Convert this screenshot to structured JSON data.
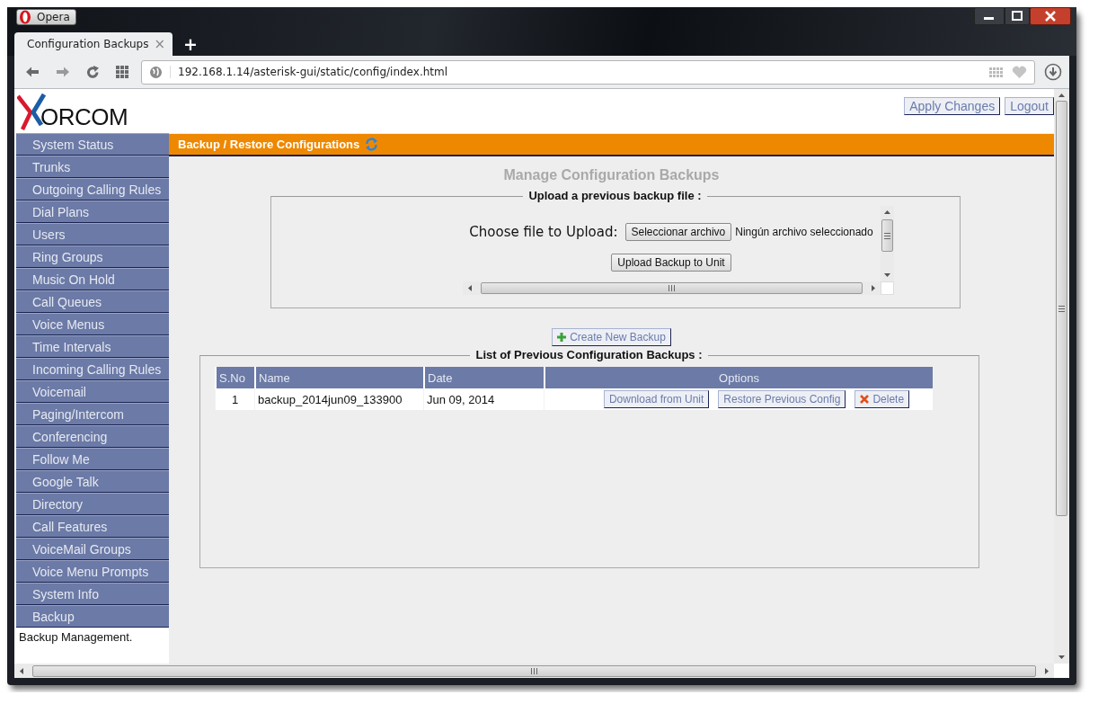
{
  "browser": {
    "menu_button": "Opera",
    "tab": {
      "title": "Configuration Backups",
      "close": "×"
    },
    "new_tab": "+",
    "url": "192.168.1.14/asterisk-gui/static/config/index.html"
  },
  "header": {
    "logo_text": "ORCOM",
    "buttons": [
      "Apply Changes",
      "Logout"
    ]
  },
  "sidebar": {
    "items": [
      "System Status",
      "Trunks",
      "Outgoing Calling Rules",
      "Dial Plans",
      "Users",
      "Ring Groups",
      "Music On Hold",
      "Call Queues",
      "Voice Menus",
      "Time Intervals",
      "Incoming Calling Rules",
      "Voicemail",
      "Paging/Intercom",
      "Conferencing",
      "Follow Me",
      "Google Talk",
      "Directory",
      "Call Features",
      "VoiceMail Groups",
      "Voice Menu Prompts",
      "System Info",
      "Backup"
    ],
    "description": "Backup Management."
  },
  "page_title": "Backup / Restore Configurations",
  "heading": "Manage Configuration Backups",
  "upload": {
    "legend": "Upload a previous backup file :",
    "label": "Choose file to Upload:",
    "file_button": "Seleccionar archivo",
    "file_status": "Ningún archivo seleccionado",
    "submit": "Upload Backup to Unit"
  },
  "create_button": "Create New Backup",
  "backups": {
    "legend": "List of Previous Configuration Backups :",
    "columns": [
      "S.No",
      "Name",
      "Date",
      "Options"
    ],
    "rows": [
      {
        "cells": [
          "1",
          "backup_2014jun09_133900",
          "Jun 09, 2014"
        ],
        "actions": [
          {
            "kind": "plain",
            "label": "Download from Unit"
          },
          {
            "kind": "plain",
            "label": "Restore Previous Config"
          },
          {
            "kind": "delete",
            "label": "Delete"
          }
        ]
      }
    ]
  }
}
